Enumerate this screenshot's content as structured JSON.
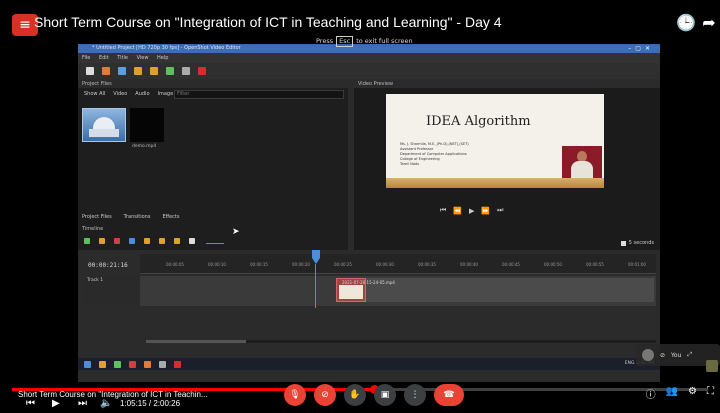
{
  "video": {
    "title": "Short Term Course on \"Integration of ICT in Teaching and Learning\" - Day 4",
    "bottom_title": "Short Term Course on \"Integration of ICT in Teachin...",
    "time": "1:05:15 / 2:00:26",
    "progress_percent": 52,
    "fullscreen_hint_before": "Press",
    "fullscreen_hint_key": "Esc",
    "fullscreen_hint_after": "to exit full screen"
  },
  "openshot": {
    "window_title": "* Untitled Project [HD 720p 30 fps] - OpenShot Video Editor",
    "menu": [
      "File",
      "Edit",
      "Title",
      "View",
      "Help"
    ],
    "project_files_label": "Project Files",
    "video_preview_label": "Video Preview",
    "filters": [
      "Show All",
      "Video",
      "Audio",
      "Image"
    ],
    "filter_placeholder": "Filter",
    "file2_name": "demo.mp4",
    "tabs": [
      "Project Files",
      "Transitions",
      "Effects"
    ],
    "timeline_label": "Timeline",
    "seconds_label": "5 seconds",
    "timecode": "00:00:21:16",
    "ruler_ticks": [
      "00:00:05",
      "00:00:10",
      "00:00:15",
      "00:00:20",
      "00:00:25",
      "00:00:30",
      "00:00:35",
      "00:00:40",
      "00:00:45",
      "00:00:50",
      "00:00:55",
      "00:01:00"
    ],
    "track_name": "Track 1",
    "clip_label": "2021-07-20 15-24-05.mp4",
    "tray_text": "ENG 3:42 PM"
  },
  "slide": {
    "title": "IDEA Algorithm",
    "lines": [
      "Ms. J. Sharmila, M.E.,(Ph.D),(NET),(SET)",
      "Assistant Professor",
      "Department of Computer Applications",
      "College of Engineering",
      "Tamil Nadu"
    ]
  },
  "selfview": {
    "label": "You"
  },
  "colors": {
    "accent_red": "#ea4335",
    "timeline_blue": "#4a8fd8",
    "titlebar_blue": "#3b6fb5"
  }
}
